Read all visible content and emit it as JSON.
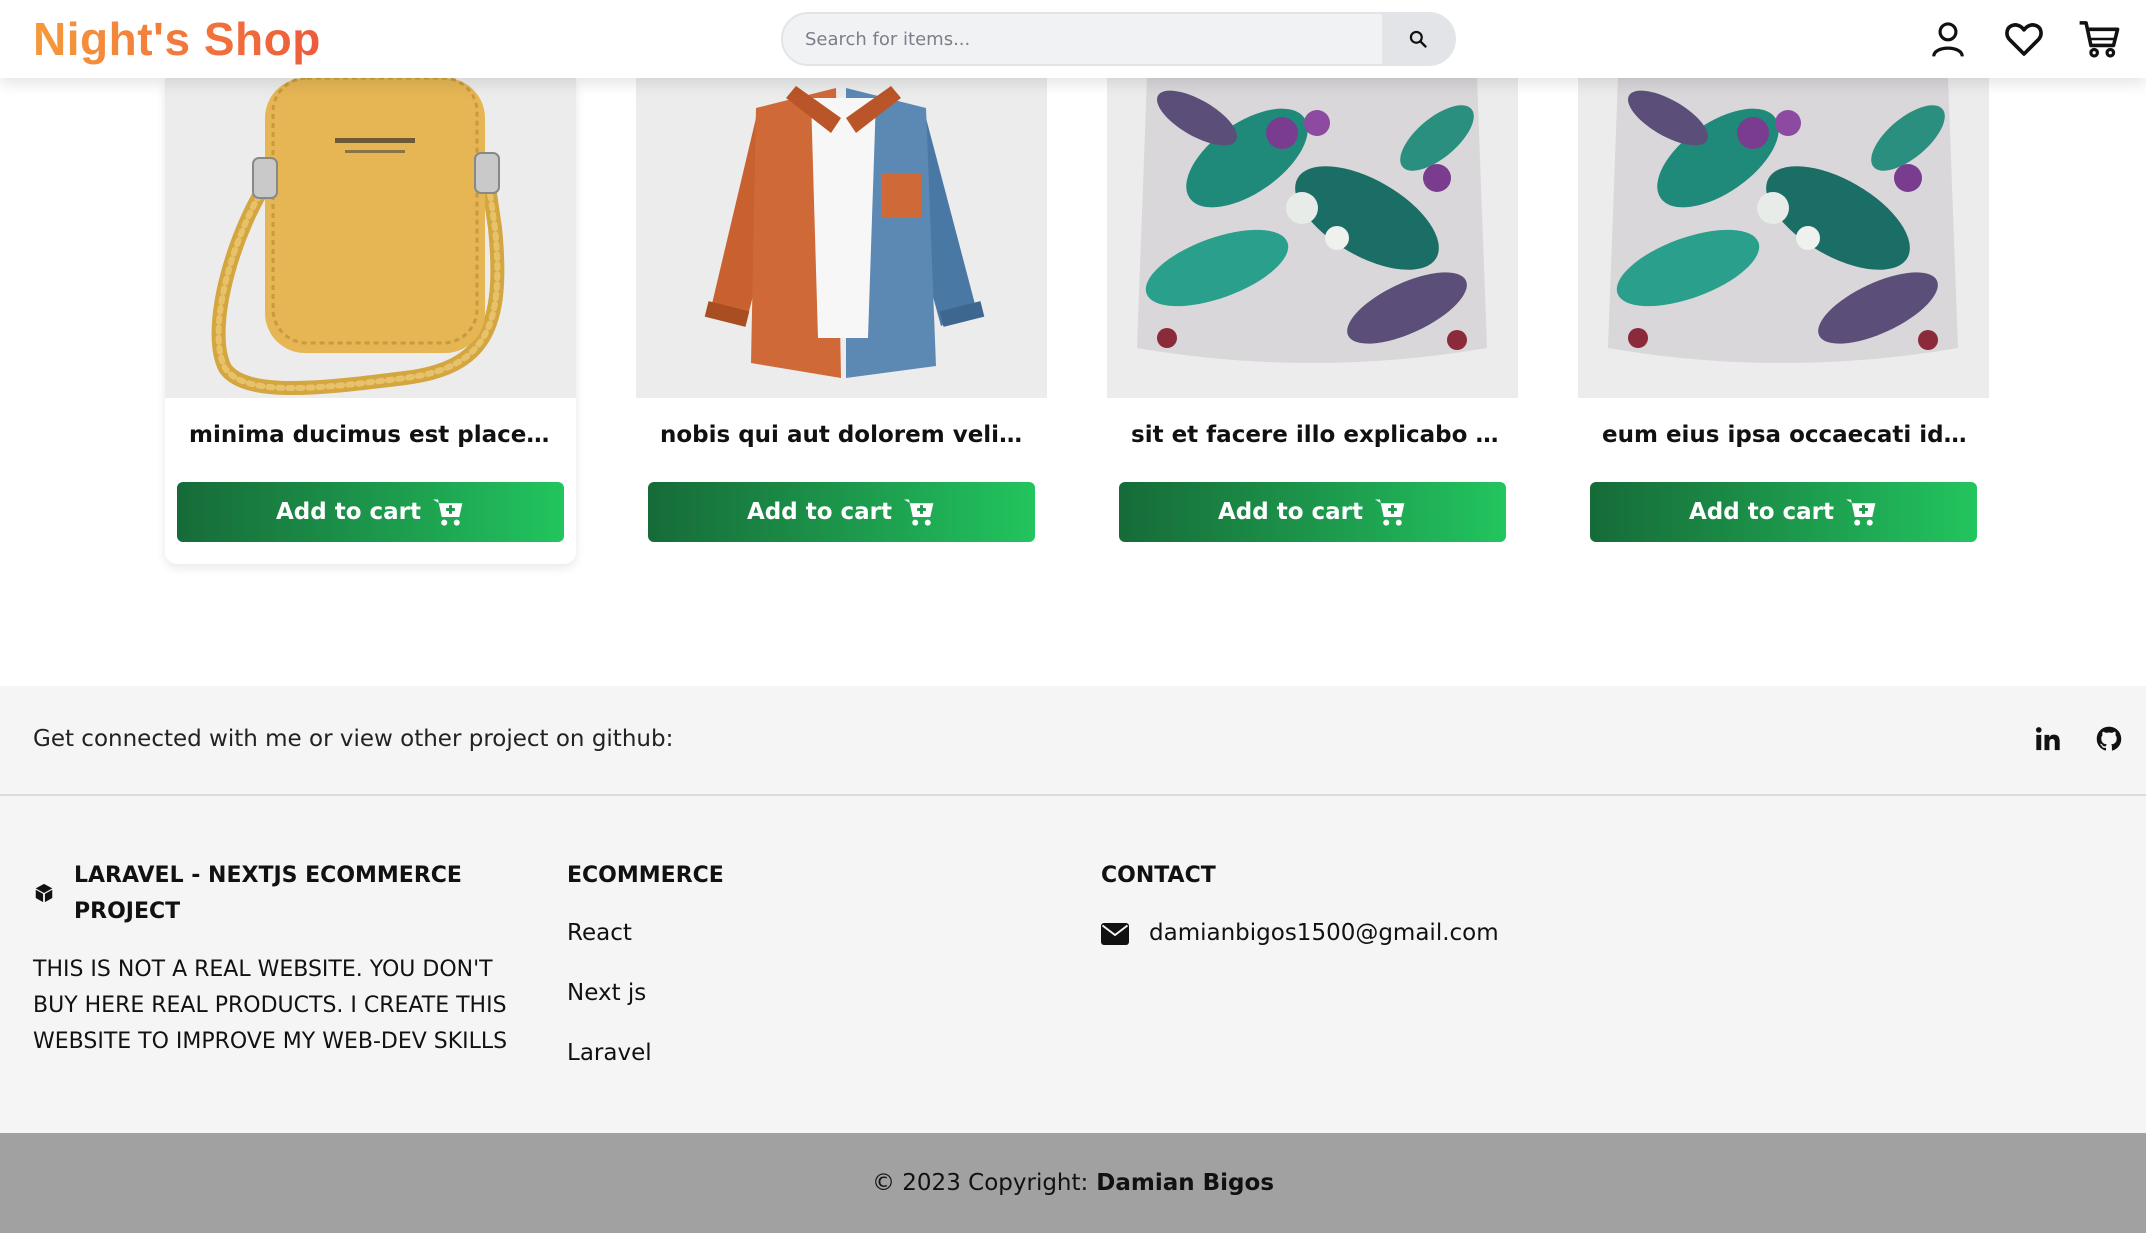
{
  "header": {
    "brand": "Night's Shop",
    "search_placeholder": "Search for items...",
    "icons": [
      "user-icon",
      "heart-icon",
      "cart-icon"
    ]
  },
  "products": [
    {
      "title": "minima ducimus est placeat d...",
      "button": "Add to cart",
      "image": "yellow crossbody phone bag"
    },
    {
      "title": "nobis qui aut dolorem velit ut",
      "button": "Add to cart",
      "image": "orange and blue corduroy shirt"
    },
    {
      "title": "sit et facere illo explicabo dicta",
      "button": "Add to cart",
      "image": "tropical leaf pillow"
    },
    {
      "title": "eum eius ipsa occaecati id aut",
      "button": "Add to cart",
      "image": "tropical leaf pillow"
    }
  ],
  "footer": {
    "social_text": "Get connected with me or view other project on github:",
    "social_icons": [
      "linkedin-icon",
      "github-icon"
    ],
    "about_title": "LARAVEL - NEXTJS ECOMMERCE PROJECT",
    "about_text": "THIS IS NOT A REAL WEBSITE. YOU DON'T BUY HERE REAL PRODUCTS. I CREATE THIS WEBSITE TO IMPROVE MY WEB-DEV SKILLS",
    "ecommerce_title": "ECOMMERCE",
    "ecommerce_links": [
      "React",
      "Next js",
      "Laravel"
    ],
    "contact_title": "CONTACT",
    "contact_email": "damianbigos1500@gmail.com",
    "copyright_prefix": "© 2023 Copyright:",
    "copyright_name": "Damian Bigos"
  },
  "colors": {
    "brand_gradient_start": "#f59a3b",
    "brand_gradient_end": "#ee5a3c",
    "button_gradient_start": "#166b38",
    "button_gradient_end": "#22c55e",
    "footer_bg": "#f5f5f5",
    "copyright_bg": "#a1a1a1"
  }
}
